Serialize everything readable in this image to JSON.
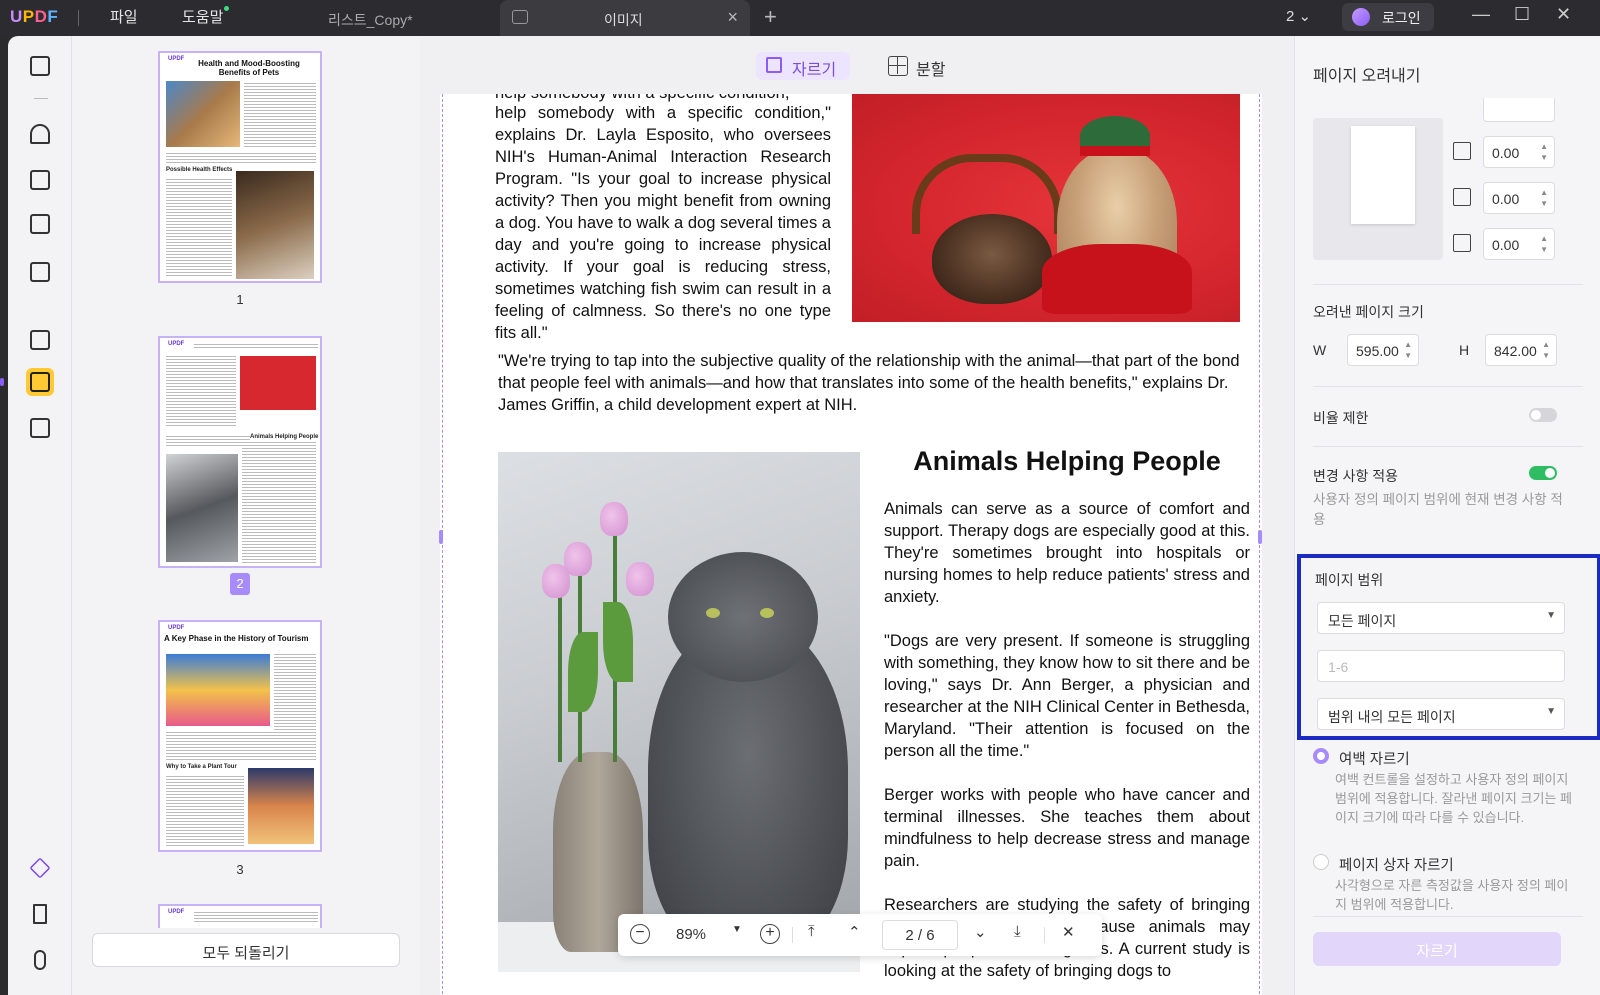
{
  "app": {
    "logo": "UPDF"
  },
  "menu": {
    "file": "파일",
    "help": "도움말"
  },
  "tabs": [
    {
      "label": "리스트_Copy*",
      "active": false
    },
    {
      "label": "이미지",
      "active": true
    }
  ],
  "titlebar": {
    "page_count": "2",
    "login": "로그인"
  },
  "thumbnails": {
    "pages": [
      {
        "number": "1",
        "title": "Health and Mood-Boosting Benefits of Pets",
        "subhead": "Possible Health Effects"
      },
      {
        "number": "2",
        "title": "",
        "subhead": "Animals Helping People"
      },
      {
        "number": "3",
        "title": "A Key Phase in the History of Tourism",
        "subhead": "Why to Take a Plant Tour"
      }
    ],
    "reset_label": "모두 되돌리기"
  },
  "crop_toolbar": {
    "crop_label": "자르기",
    "split_label": "분할"
  },
  "document": {
    "top_paragraph": "help somebody with a specific condition,\" explains Dr. Layla Esposito, who oversees NIH's Human-Animal Interaction Research Program. \"Is your goal to increase physical activity? Then you might benefit from owning a dog. You have to walk a dog several times a day and you're going to increase physical activity. If your goal is reducing stress, sometimes watching fish swim can result in a feeling of calmness. So there's no one type fits all.\"",
    "quote_paragraph": "\"We're trying to tap into the subjective quality of the relationship with the animal—that part of the bond that people feel with animals—and how that translates into some of the health benefits,\" explains Dr. James Griffin, a child development expert at NIH.",
    "heading": "Animals Helping People",
    "col_p1": "Animals can serve as a source of comfort and support. Therapy dogs are especially good at this. They're sometimes brought into hospitals or nursing homes to help reduce patients' stress and anxiety.",
    "col_p2": "\"Dogs are very present. If someone is struggling with something, they know how to sit there and be loving,\" says Dr. Ann Berger, a physician and researcher at the NIH Clinical Center in Bethesda, Maryland. \"Their attention is focused on the person all the time.\"",
    "col_p3": "Berger works with people who have cancer and terminal illnesses. She teaches them about mindfulness to help decrease stress and manage pain.",
    "col_p4": "Researchers are studying the safety of bringing animals into hospitals because animals may expose people to more germs. A current study is looking at the safety of bringing dogs to"
  },
  "zoombar": {
    "zoom": "89%",
    "page_current": "2",
    "page_sep": "/",
    "page_total": "6"
  },
  "right_panel": {
    "title": "페이지 오려내기",
    "margins": {
      "top": "0.00",
      "left": "0.00",
      "right": "0.00"
    },
    "cropped_size_label": "오려낸 페이지 크기",
    "width_label": "W",
    "width_value": "595.00",
    "height_label": "H",
    "height_value": "842.00",
    "ratio_lock_label": "비율 제한",
    "ratio_lock_on": false,
    "apply_changes_label": "변경 사항 적용",
    "apply_changes_on": true,
    "apply_changes_desc": "사용자 정의 페이지 범위에 현재 변경 사항 적용",
    "page_range_label": "페이지 범위",
    "page_range_select": "모든 페이지",
    "page_range_placeholder": "1-6",
    "page_subset_select": "범위 내의 모든 페이지",
    "option_margin_label": "여백 자르기",
    "option_margin_desc": "여백 컨트롤을 설정하고 사용자 정의 페이지 범위에 적용합니다. 잘라낸 페이지 크기는 페이지 크기에 따라 다를 수 있습니다.",
    "option_box_label": "페이지 상자 자르기",
    "option_box_desc": "사각형으로 자른 측정값을 사용자 정의 페이지 범위에 적용합니다.",
    "crop_button": "자르기"
  },
  "colors": {
    "accent": "#8b5cf6",
    "highlight_border": "#1c2bbf",
    "toggle_on": "#2fbd64",
    "active_tool": "#ffc933"
  }
}
